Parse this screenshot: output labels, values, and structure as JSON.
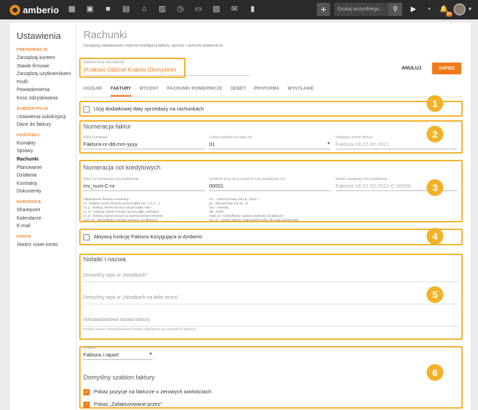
{
  "app": {
    "logo": "amberio"
  },
  "topbar": {
    "search_placeholder": "Szukaj wszystkiego...",
    "notifications_count": "36"
  },
  "sidebar": {
    "title": "Ustawienia",
    "sections": [
      {
        "title": "PREFERENCJE",
        "items": [
          "Zarządzaj kontem",
          "Stawki firmowe",
          "Zarządzaj użytkownikami",
          "Profil",
          "Powiadomienia",
          "Kosz odzyskiwania"
        ]
      },
      {
        "title": "SUBSKRYPCJA",
        "items": [
          "Ustawienia subskrypcji",
          "Dane do faktury"
        ]
      },
      {
        "title": "DOSTOSUJ",
        "items": [
          "Kontakty",
          "Sprawy",
          "Rachunki",
          "Planowanie",
          "Działania",
          "Kontrakty",
          "Dokumenty"
        ]
      },
      {
        "title": "NARZĘDZIA",
        "items": [
          "Sharepoint",
          "Kalendarze",
          "E-mail"
        ]
      },
      {
        "title": "KONTA",
        "items": [
          "Stwórz nowe konto"
        ]
      }
    ],
    "active": "Rachunki"
  },
  "header": {
    "title": "Rachunki",
    "subtitle": "Zarządzaj ustawieniami rozliczeń konfiguruj faktury, wyceny i rachunki powiernicze",
    "company_label": "Wybierz firmę (lub oddział)",
    "company_value": "(Kraków) Oddział Kraków (Domyślne)",
    "cancel_label": "ANULUJ",
    "save_label": "ZAPISZ"
  },
  "tabs": [
    "OGÓLNE",
    "FAKTURY",
    "WYCENY",
    "RACHUNKI POWIERNICZE",
    "DEBET",
    "PROFORMA",
    "WYSYŁANIE"
  ],
  "active_tab": "FAKTURY",
  "callouts": [
    "1",
    "2",
    "3",
    "4",
    "5",
    "6"
  ],
  "highlight_color": "#f2b227",
  "accent_color": "#f07a1a",
  "sale_date": {
    "label": "Użyj dodatkowej daty sprzedaży na rachunkach",
    "checked": false
  },
  "invoice_numbering": {
    "title": "Numeracja faktur",
    "pattern_label": "Wzór numeracji",
    "pattern_value": "Faktura-nr-dd-mm-yyyy",
    "digits_label": "Liczba symboli w liczbie (nr)",
    "digits_value": "01",
    "next_label": "Następny numer faktury",
    "next_value": "Faktura-18-22-02-2021"
  },
  "credit_numbering": {
    "title": "Numeracja not kredytowych",
    "pattern_label": "Wzór na numerację noty kredytowej",
    "pattern_value": "inv_num-C-nr",
    "digits_label": "Symbole liczą się w numerze noty kredytowej (nr)",
    "digits_value": "00001",
    "next_label": "Numer następnej noty kredytowej...",
    "next_value": "Faktura-18-22-02-2021-C-00006",
    "explain_left": [
      "Objaśnienie formatu numeracji:",
      "nr - kolejny numer liczony od początku (np. 1,2,3 ...)",
      "nr_y - kolejny numer liczony od początku roku",
      "nr_m - kolejny numer liczony od początku miesiąca",
      "nr_d - kolejny numer liczony w wyznaczonym terminie",
      "cont_id - identyfikator sprawy wybrany na fakturze"
    ],
    "explain_right": [
      "rrrr - czterocyfrowy rok np. 2011 r",
      "yy - dwucyfrowy rok np. 11",
      "mm - miesiąc",
      "dd - dzień",
      "matt_id - identyfikator sprawy wybrany na fakturze",
      "inv_nr - numer faktury (odpowiedni tylko dla noty kredytowej)"
    ]
  },
  "corrective": {
    "label": "Aktywuj funkcję Faktura Korygująca w Amberio",
    "checked": false
  },
  "notes": {
    "title": "Notatki i nazwa",
    "field1_placeholder": "Domyślny wpis w „Notatkach\"",
    "field2_placeholder": "Domyślny wpis w „Notatkach na dole strony\"",
    "field3_placeholder": "Niestandardowa nazwa faktury",
    "field3_hint": "Podana nazwa niestandardowa zostanie zastąpiona we wszystkich językach"
  },
  "template": {
    "label": "Szablon",
    "value": "Faktura i raport",
    "default_title": "Domyślny szablon faktury",
    "opt1": "Pokaż pozycje na fakturze o zerowych wartościach",
    "opt2": "Pokaż „Zafakturowane przez\""
  }
}
